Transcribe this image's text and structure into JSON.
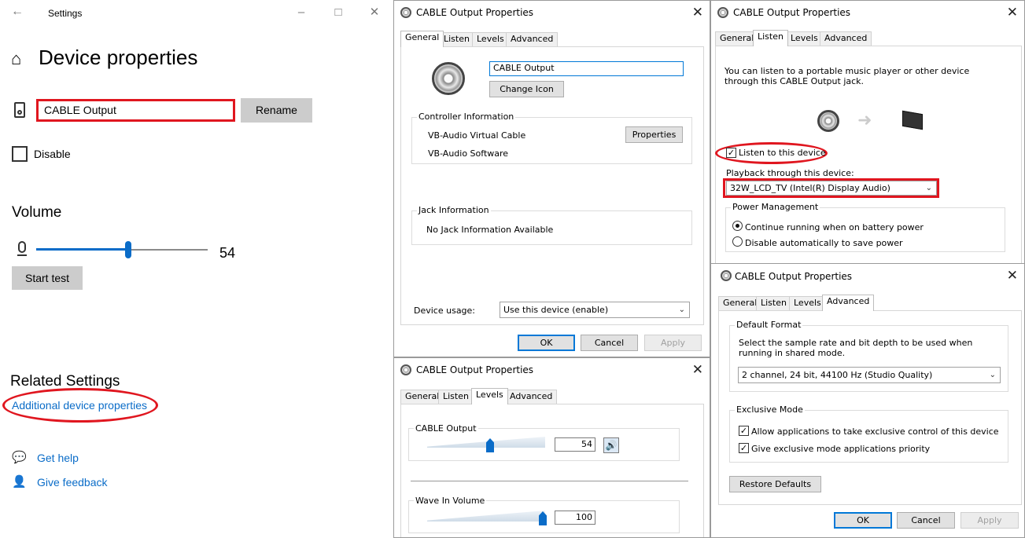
{
  "settings": {
    "window_title": "Settings",
    "page_title": "Device properties",
    "device_name_value": "CABLE Output",
    "rename_label": "Rename",
    "disable_label": "Disable",
    "volume_heading": "Volume",
    "volume_value": "54",
    "volume_level": 54,
    "start_test_label": "Start test",
    "related_heading": "Related Settings",
    "additional_link": "Additional device properties",
    "get_help": "Get help",
    "give_feedback": "Give feedback"
  },
  "general_dialog": {
    "title": "CABLE Output Properties",
    "tabs": [
      "General",
      "Listen",
      "Levels",
      "Advanced"
    ],
    "active_tab": "General",
    "name_value": "CABLE Output",
    "change_icon": "Change Icon",
    "controller_heading": "Controller Information",
    "controller_name": "VB-Audio Virtual Cable",
    "controller_vendor": "VB-Audio Software",
    "properties_label": "Properties",
    "jack_heading": "Jack Information",
    "jack_text": "No Jack Information Available",
    "device_usage_label": "Device usage:",
    "device_usage_value": "Use this device (enable)",
    "ok": "OK",
    "cancel": "Cancel",
    "apply": "Apply"
  },
  "levels_dialog": {
    "title": "CABLE Output Properties",
    "tabs": [
      "General",
      "Listen",
      "Levels",
      "Advanced"
    ],
    "active_tab": "Levels",
    "cable_output_label": "CABLE Output",
    "cable_output_value": "54",
    "wave_in_label": "Wave In Volume",
    "wave_in_value": "100"
  },
  "listen_dialog": {
    "title": "CABLE Output Properties",
    "tabs": [
      "General",
      "Listen",
      "Levels",
      "Advanced"
    ],
    "active_tab": "Listen",
    "description": "You can listen to a portable music player or other device through this CABLE Output jack.",
    "listen_checkbox": "Listen to this device",
    "listen_checked": true,
    "playback_label": "Playback through this device:",
    "playback_value": "32W_LCD_TV (Intel(R) Display Audio)",
    "power_heading": "Power Management",
    "power_option_1": "Continue running when on battery power",
    "power_option_2": "Disable automatically to save power"
  },
  "advanced_dialog": {
    "title": "CABLE Output Properties",
    "tabs": [
      "General",
      "Listen",
      "Levels",
      "Advanced"
    ],
    "active_tab": "Advanced",
    "default_format_heading": "Default Format",
    "default_format_desc": "Select the sample rate and bit depth to be used when running in shared mode.",
    "format_value": "2 channel, 24 bit, 44100 Hz (Studio Quality)",
    "exclusive_heading": "Exclusive Mode",
    "exclusive_opt_1": "Allow applications to take exclusive control of this device",
    "exclusive_opt_2": "Give exclusive mode applications priority",
    "restore_defaults": "Restore Defaults",
    "ok": "OK",
    "cancel": "Cancel",
    "apply": "Apply"
  },
  "accent_colors": {
    "windows_blue": "#0a6cc8",
    "annotation_red": "#e0161f"
  }
}
